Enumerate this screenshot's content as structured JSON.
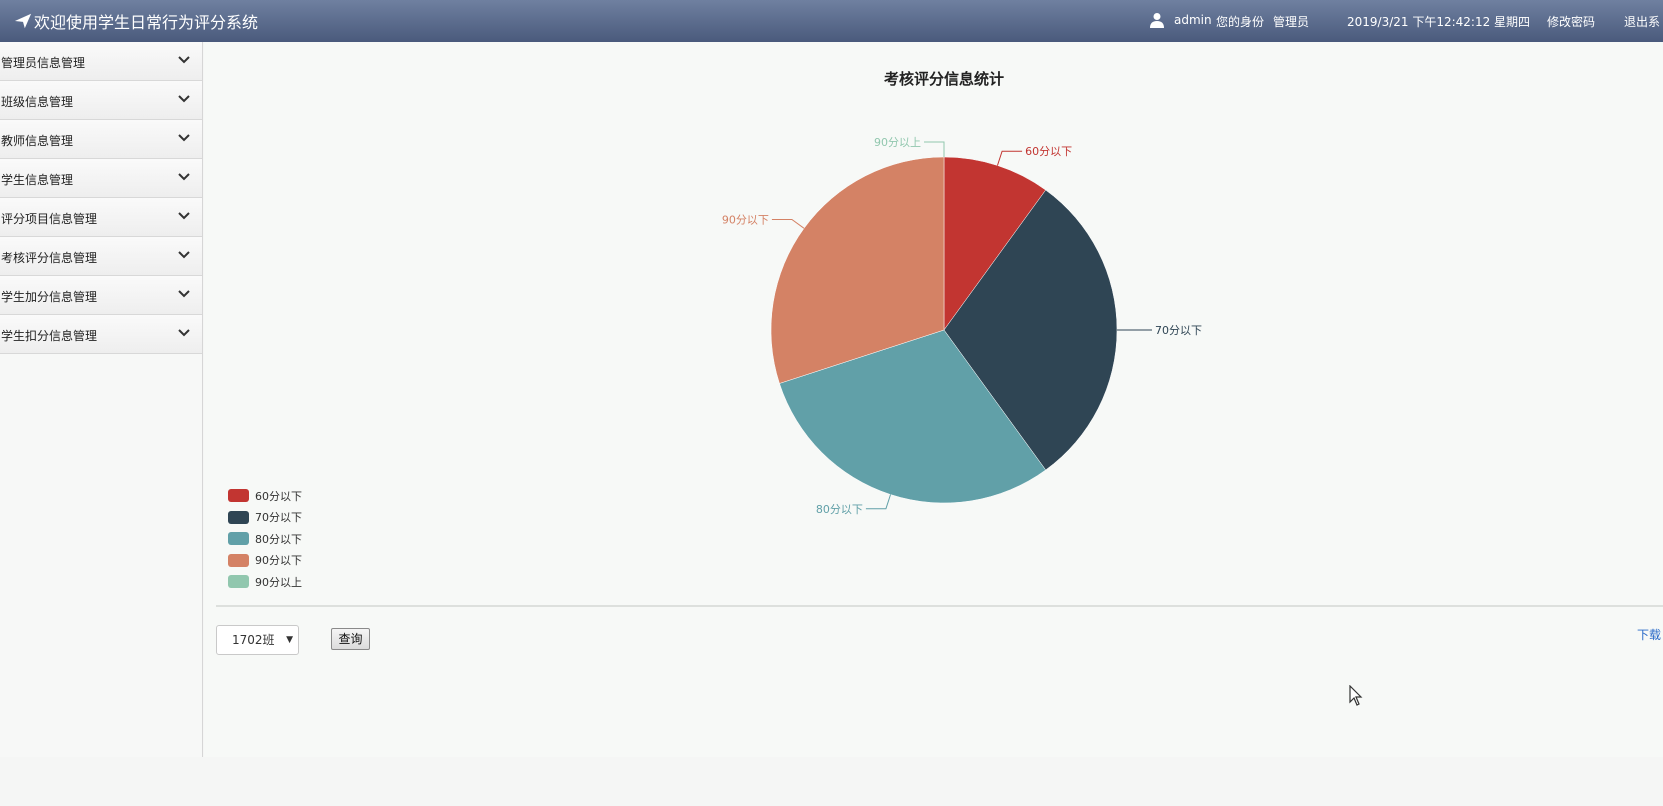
{
  "header": {
    "title": "欢迎使用学生日常行为评分系统",
    "username": "admin",
    "role_label": "您的身份",
    "role": "管理员",
    "datetime": "2019/3/21 下午12:42:12 星期四",
    "change_password": "修改密码",
    "logout": "退出系"
  },
  "sidebar": {
    "items": [
      {
        "label": "管理员信息管理"
      },
      {
        "label": "班级信息管理"
      },
      {
        "label": "教师信息管理"
      },
      {
        "label": "学生信息管理"
      },
      {
        "label": "评分项目信息管理"
      },
      {
        "label": "考核评分信息管理"
      },
      {
        "label": "学生加分信息管理"
      },
      {
        "label": "学生扣分信息管理"
      }
    ]
  },
  "controls": {
    "class_value": "1702班",
    "query_label": "查询",
    "download_label": "下载"
  },
  "chart_data": {
    "type": "pie",
    "title": "考核评分信息统计",
    "legend_position": "bottom-left",
    "categories": [
      "60分以下",
      "70分以下",
      "80分以下",
      "90分以下",
      "90分以上"
    ],
    "values": [
      10,
      30,
      30,
      30,
      0
    ],
    "colors": [
      "#c23531",
      "#2f4554",
      "#61a0a8",
      "#d48265",
      "#91c7ae"
    ]
  }
}
